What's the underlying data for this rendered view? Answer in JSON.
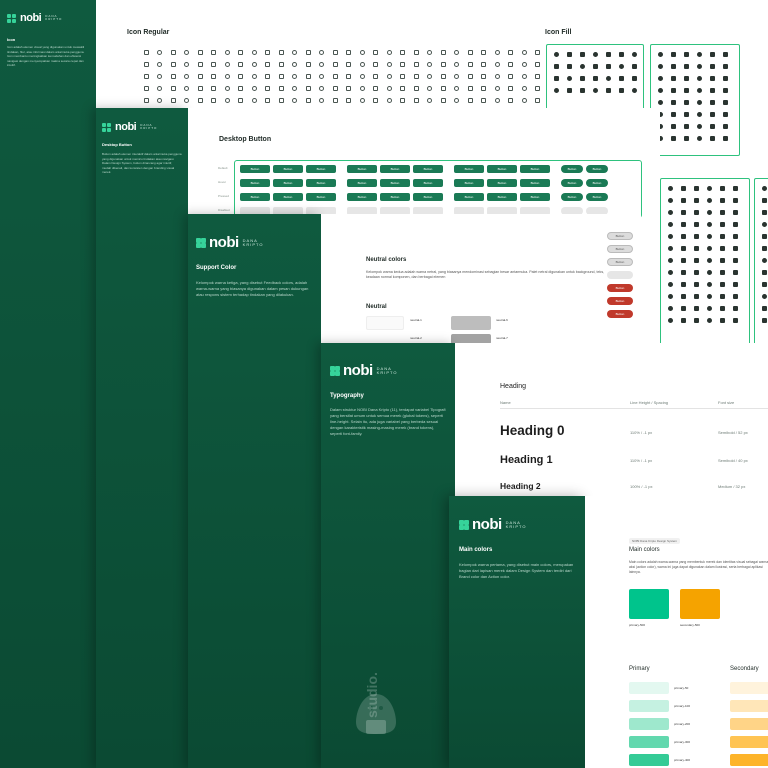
{
  "brand": {
    "word": "nobi",
    "sub_line1": "DANA",
    "sub_line2": "KRIPTO",
    "watermark": "studio."
  },
  "colors": {
    "green_dark": "#0b4a33",
    "primary": "#00c48c",
    "secondary": "#f5a300"
  },
  "icon_panel": {
    "left_title": "Icon",
    "left_desc": "Icon adalah elemen visual yang digunakan untuk mewakili tindakan, fitur, atau informasi dalam antarmuka pengguna. Icon membantu meningkatkan kemudahan dan efisiensi navigasi dengan menyampaikan makna secara cepat dan intuitif.",
    "regular_title": "Icon Regular",
    "fill_title": "Icon Fill"
  },
  "button_panel": {
    "left_title": "Desktop Button",
    "left_desc": "Button adalah elemen interaktif dalam antarmuka pengguna yang digunakan untuk memicu tindakan atau navigasi. Dalam Design System, button dirancang agar intuitif, mudah dikenali, dan konsisten dengan branding visual merek.",
    "title": "Desktop Button",
    "row_labels": [
      "Default",
      "Hover",
      "Pressed",
      "Disabled"
    ],
    "btn_label": "Button"
  },
  "support_panel": {
    "left_title": "Support Color",
    "left_desc": "Kelompok warna ketiga, yang disebut Feedback colors, adalah warna-warna yang biasanya digunakan dalam pesan dukungan atau respons sistem terhadap tindakan yang dilakukan.",
    "neutral_title": "Neutral colors",
    "neutral_desc": "Kelompok warna kedua adalah warna netral, yang biasanya mendominasi sebagian besar antarmuka. Palet netral digunakan untuk background, teks, keadaan normal komponen, dan berbagai elemen",
    "neutral_heading": "Neutral",
    "swatches": [
      {
        "name": "neutral-1",
        "hex": "#fafafa"
      },
      {
        "name": "neutral-2",
        "hex": "#f2f2f2"
      },
      {
        "name": "neutral-6",
        "hex": "#bdbdbd"
      },
      {
        "name": "neutral-7",
        "hex": "#a3a3a3"
      }
    ]
  },
  "typography_panel": {
    "left_title": "Typography",
    "left_desc": "Dalam struktur NOBI Dana Kripto (11), terdapat variabel Tipografi yang bersifat umum untuk semua merek (global tokens), seperti line-height. Selain itu, ada juga variabel yang berbeda sesuai dengan karakteristik masing-masing merek (brand tokens), seperti font-family.",
    "heading": "Heading",
    "col_name": "Name",
    "col_lh": "Line Height / Spacing",
    "col_fs": "Font size",
    "rows": [
      {
        "name": "Heading 0",
        "lh": "110% / -1 px",
        "fs": "Semibold / 52 px"
      },
      {
        "name": "Heading 1",
        "lh": "110% / -1 px",
        "fs": "Semibold / 40 px"
      },
      {
        "name": "Heading 2",
        "lh": "100% / -1 px",
        "fs": "Medium / 32 px"
      }
    ]
  },
  "main_panel": {
    "left_title": "Main colors",
    "left_desc": "Kelompok warna pertama, yang disebut main colors, merupakan bagian dari lapisan merek dalam Design System dan terdiri dari Brand color dan Action color.",
    "chip": "NOBI Dana Kripto Design System",
    "title": "Main colors",
    "desc": "Main colors adalah warna-warna yang membentuk merek dan identitas visual sebagai warna aksi (action color), warna ini juga dapat digunakan dalam ilustrasi, serta berbagai aplikasi lainnya.",
    "primary_label": "primary-500",
    "secondary_label": "secondary-500",
    "primary_col": "Primary",
    "secondary_col": "Secondary",
    "primary_list": [
      "primary-50",
      "primary-100",
      "primary-200",
      "primary-300",
      "primary-400"
    ]
  }
}
